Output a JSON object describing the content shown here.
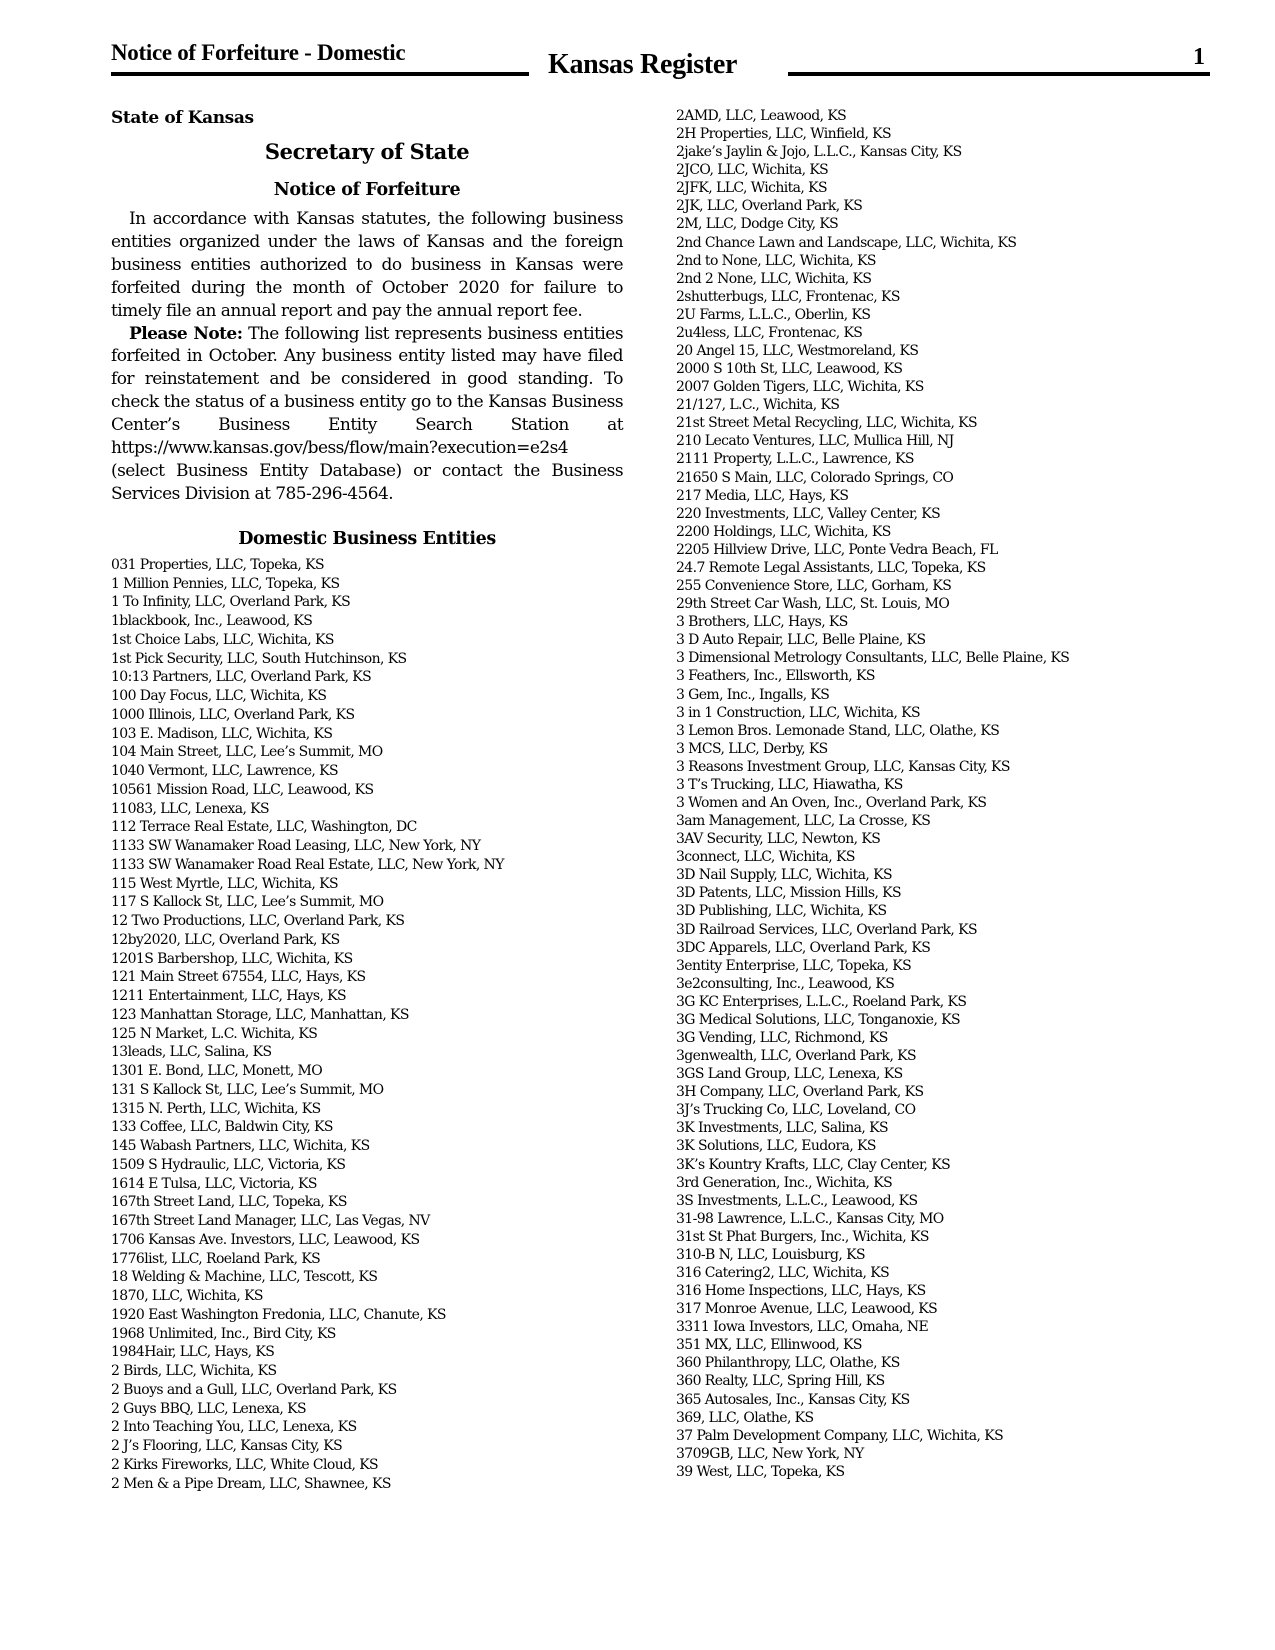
{
  "header": {
    "section_title": "Notice of Forfeiture - Domestic",
    "publication": "Kansas Register",
    "page_number": "1"
  },
  "notice": {
    "state": "State of Kansas",
    "agency": "Secretary of State",
    "title": "Notice of Forfeiture",
    "paragraph1": "In accordance with Kansas statutes, the following business entities organized under the laws of Kansas and the foreign business entities authorized to do business in Kansas were forfeited during the month of October 2020 for failure to timely file an annual report and pay the annual report fee.",
    "note_label": "Please Note:",
    "paragraph2": " The following list represents business entities forfeited in October. Any business entity listed may have filed for reinstatement and be considered in good standing. To check the status of a business entity go to the Kansas Business Center’s Business Entity Search Station at https://www.kansas.gov/bess/flow/main?execution=e2s4 (select Business Entity Database) or contact the Business Services Division at 785-296-4564.",
    "list_title": "Domestic Business Entities"
  },
  "entities_left": [
    "031 Properties, LLC, Topeka, KS",
    "1 Million Pennies, LLC, Topeka, KS",
    "1 To Infinity, LLC, Overland Park, KS",
    "1blackbook, Inc., Leawood, KS",
    "1st Choice Labs, LLC, Wichita, KS",
    "1st Pick Security, LLC, South Hutchinson, KS",
    "10:13 Partners, LLC, Overland Park, KS",
    "100 Day Focus, LLC, Wichita, KS",
    "1000 Illinois, LLC, Overland Park, KS",
    "103 E. Madison, LLC, Wichita, KS",
    "104 Main Street, LLC, Lee’s Summit, MO",
    "1040 Vermont, LLC, Lawrence, KS",
    "10561 Mission Road, LLC, Leawood, KS",
    "11083, LLC, Lenexa, KS",
    "112 Terrace Real Estate, LLC, Washington, DC",
    "1133 SW Wanamaker Road Leasing, LLC, New York, NY",
    "1133 SW Wanamaker Road Real Estate, LLC, New York, NY",
    "115 West Myrtle, LLC, Wichita, KS",
    "117 S Kallock St, LLC, Lee’s Summit, MO",
    "12 Two Productions, LLC, Overland Park, KS",
    "12by2020, LLC, Overland Park, KS",
    "1201S Barbershop, LLC, Wichita, KS",
    "121 Main Street 67554, LLC, Hays, KS",
    "1211 Entertainment, LLC, Hays, KS",
    "123 Manhattan Storage, LLC, Manhattan, KS",
    "125 N Market, L.C. Wichita, KS",
    "13leads, LLC, Salina, KS",
    "1301 E. Bond, LLC, Monett, MO",
    "131 S Kallock St, LLC, Lee’s Summit, MO",
    "1315 N. Perth, LLC, Wichita, KS",
    "133 Coffee, LLC, Baldwin City, KS",
    "145 Wabash Partners, LLC, Wichita, KS",
    "1509 S Hydraulic, LLC, Victoria, KS",
    "1614 E Tulsa, LLC, Victoria, KS",
    "167th Street Land, LLC, Topeka, KS",
    "167th Street Land Manager, LLC, Las Vegas, NV",
    "1706 Kansas Ave. Investors, LLC, Leawood, KS",
    "1776list, LLC, Roeland Park, KS",
    "18 Welding & Machine, LLC, Tescott, KS",
    "1870, LLC, Wichita, KS",
    "1920 East Washington Fredonia, LLC, Chanute, KS",
    "1968 Unlimited, Inc., Bird City, KS",
    "1984Hair, LLC, Hays, KS",
    "2 Birds, LLC, Wichita, KS",
    "2 Buoys and a Gull, LLC, Overland Park, KS",
    "2 Guys BBQ, LLC, Lenexa, KS",
    "2 Into Teaching You, LLC, Lenexa, KS",
    "2 J’s Flooring, LLC, Kansas City, KS",
    "2 Kirks Fireworks, LLC, White Cloud, KS",
    "2 Men & a Pipe Dream, LLC, Shawnee, KS"
  ],
  "entities_right": [
    "2AMD, LLC, Leawood, KS",
    "2H Properties, LLC, Winfield, KS",
    "2jake’s Jaylin & Jojo, L.L.C., Kansas City, KS",
    "2JCO, LLC, Wichita, KS",
    "2JFK, LLC, Wichita, KS",
    "2JK, LLC, Overland Park, KS",
    "2M, LLC, Dodge City, KS",
    "2nd Chance Lawn and Landscape, LLC, Wichita, KS",
    "2nd to None, LLC, Wichita, KS",
    "2nd 2 None, LLC, Wichita, KS",
    "2shutterbugs, LLC, Frontenac, KS",
    "2U Farms, L.L.C., Oberlin, KS",
    "2u4less, LLC, Frontenac, KS",
    "20 Angel 15, LLC, Westmoreland, KS",
    "2000 S 10th St, LLC, Leawood, KS",
    "2007 Golden Tigers, LLC, Wichita, KS",
    "21/127, L.C., Wichita, KS",
    "21st Street Metal Recycling, LLC, Wichita, KS",
    "210 Lecato Ventures, LLC, Mullica Hill, NJ",
    "2111 Property, L.L.C., Lawrence, KS",
    "21650 S Main, LLC, Colorado Springs, CO",
    "217 Media, LLC, Hays, KS",
    "220 Investments, LLC, Valley Center, KS",
    "2200 Holdings, LLC, Wichita, KS",
    "2205 Hillview Drive, LLC, Ponte Vedra Beach, FL",
    "24.7 Remote Legal Assistants, LLC, Topeka, KS",
    "255 Convenience Store, LLC, Gorham, KS",
    "29th Street Car Wash, LLC, St. Louis, MO",
    "3 Brothers, LLC, Hays, KS",
    "3 D Auto Repair, LLC, Belle Plaine, KS",
    "3 Dimensional Metrology Consultants, LLC, Belle Plaine, KS",
    "3 Feathers, Inc., Ellsworth, KS",
    "3 Gem, Inc., Ingalls, KS",
    "3 in 1 Construction, LLC, Wichita, KS",
    "3 Lemon Bros. Lemonade Stand, LLC, Olathe, KS",
    "3 MCS, LLC, Derby, KS",
    "3 Reasons Investment Group, LLC, Kansas City, KS",
    "3 T’s Trucking, LLC, Hiawatha, KS",
    "3 Women and An Oven, Inc., Overland Park, KS",
    "3am Management, LLC, La Crosse, KS",
    "3AV Security, LLC, Newton, KS",
    "3connect, LLC, Wichita, KS",
    "3D Nail Supply, LLC, Wichita, KS",
    "3D Patents, LLC, Mission Hills, KS",
    "3D Publishing, LLC, Wichita, KS",
    "3D Railroad Services, LLC, Overland Park, KS",
    "3DC Apparels, LLC, Overland Park, KS",
    "3entity Enterprise, LLC, Topeka, KS",
    "3e2consulting, Inc., Leawood, KS",
    "3G KC Enterprises, L.L.C., Roeland Park, KS",
    "3G Medical Solutions, LLC, Tonganoxie, KS",
    "3G Vending, LLC, Richmond, KS",
    "3genwealth, LLC, Overland Park, KS",
    "3GS Land Group, LLC, Lenexa, KS",
    "3H Company, LLC, Overland Park, KS",
    "3J’s Trucking Co, LLC, Loveland, CO",
    "3K Investments, LLC, Salina, KS",
    "3K Solutions, LLC, Eudora, KS",
    "3K’s Kountry Krafts, LLC, Clay Center, KS",
    "3rd Generation, Inc., Wichita, KS",
    "3S Investments, L.L.C., Leawood, KS",
    "31-98 Lawrence, L.L.C., Kansas City, MO",
    "31st St Phat Burgers, Inc., Wichita, KS",
    "310-B N, LLC, Louisburg, KS",
    "316 Catering2, LLC, Wichita, KS",
    "316 Home Inspections, LLC, Hays, KS",
    "317 Monroe Avenue, LLC, Leawood, KS",
    "3311 Iowa Investors, LLC, Omaha, NE",
    "351 MX, LLC, Ellinwood, KS",
    "360 Philanthropy, LLC, Olathe, KS",
    "360 Realty, LLC, Spring Hill, KS",
    "365 Autosales, Inc., Kansas City, KS",
    "369, LLC, Olathe, KS",
    "37 Palm Development Company, LLC, Wichita, KS",
    "3709GB, LLC, New York, NY",
    "39 West, LLC, Topeka, KS"
  ]
}
